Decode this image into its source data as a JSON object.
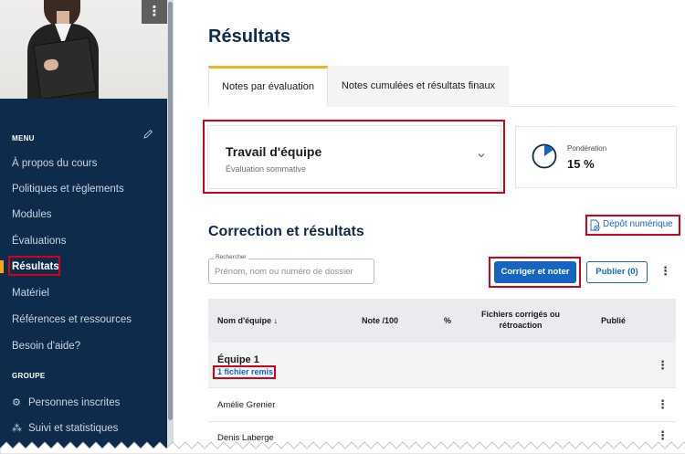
{
  "sidebar": {
    "menu_title": "MENU",
    "items": [
      {
        "label": "À propos du cours"
      },
      {
        "label": "Politiques et règlements"
      },
      {
        "label": "Modules"
      },
      {
        "label": "Évaluations"
      },
      {
        "label": "Résultats"
      },
      {
        "label": "Matériel"
      },
      {
        "label": "Références et ressources"
      },
      {
        "label": "Besoin d'aide?"
      }
    ],
    "group_title": "GROUPE",
    "group_items": [
      {
        "label": "Personnes inscrites",
        "icon": "people-icon"
      },
      {
        "label": "Suivi et statistiques",
        "icon": "stats-icon"
      }
    ]
  },
  "page": {
    "title": "Résultats",
    "tabs": [
      {
        "label": "Notes par évaluation"
      },
      {
        "label": "Notes cumulées et résultats finaux"
      }
    ]
  },
  "evaluation": {
    "name": "Travail d'équipe",
    "type": "Évaluation sommative"
  },
  "weighting": {
    "label": "Pondération",
    "value_text": "15 %",
    "percent": 15
  },
  "correction": {
    "title": "Correction et résultats",
    "depot_label": "Dépôt numérique",
    "search_legend": "Rechercher",
    "search_placeholder": "Prénom, nom ou numéro de dossier",
    "correct_button": "Corriger et noter",
    "publish_button": "Publier (0)"
  },
  "table": {
    "headers": {
      "team": "Nom d'équipe ↓",
      "grade": "Note /100",
      "percent": "%",
      "files_line1": "Fichiers corrigés ou",
      "files_line2": "rétroaction",
      "published": "Publié"
    },
    "group": {
      "name": "Équipe 1",
      "files_link": "1 fichier remis"
    },
    "members": [
      {
        "name": "Amélie Grenier"
      },
      {
        "name": "Denis Laberge"
      }
    ]
  },
  "colors": {
    "sidebar_bg": "#0f2b4b",
    "accent": "#f0b323",
    "primary": "#1565c0",
    "highlight": "#d0021b"
  }
}
